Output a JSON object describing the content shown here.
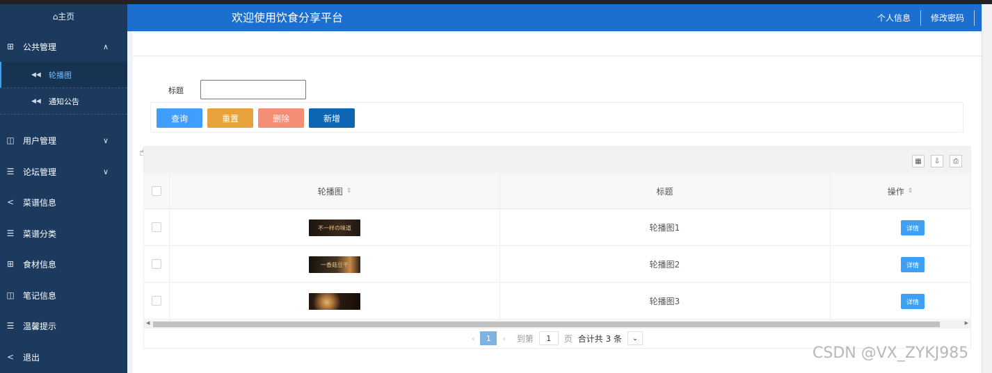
{
  "sidebar": {
    "home": {
      "icon": "home-icon",
      "label": "⌂主页"
    },
    "items": [
      {
        "icon": "grid-icon",
        "label": "公共管理",
        "chevron": "∧"
      },
      {
        "icon": "book-icon",
        "label": "用户管理",
        "chevron": "∨"
      },
      {
        "icon": "list-icon",
        "label": "论坛管理",
        "chevron": "∨"
      },
      {
        "icon": "share-icon",
        "label": "菜谱信息"
      },
      {
        "icon": "list-icon",
        "label": "菜谱分类"
      },
      {
        "icon": "grid-icon",
        "label": "食材信息"
      },
      {
        "icon": "book-icon",
        "label": "笔记信息"
      },
      {
        "icon": "list-icon",
        "label": "温馨提示"
      },
      {
        "icon": "share-icon",
        "label": "退出"
      }
    ],
    "subitems": [
      {
        "icon": "rewind-icon",
        "label": "轮播图",
        "active": true
      },
      {
        "icon": "rewind-icon",
        "label": "通知公告"
      }
    ]
  },
  "header": {
    "title": "欢迎使用饮食分享平台",
    "links": [
      "个人信息",
      "修改密码"
    ],
    "color": "#1c6fcf"
  },
  "search": {
    "label": "标题",
    "value": ""
  },
  "buttons": {
    "query": {
      "label": "查询",
      "color": "#409eff"
    },
    "reset": {
      "label": "重置",
      "color": "#e6a23c"
    },
    "delete": {
      "label": "删除",
      "color": "#f38d73"
    },
    "add": {
      "label": "新增",
      "color": "#0d66b3"
    }
  },
  "table": {
    "columns": [
      "轮播图",
      "标题",
      "操作"
    ],
    "sort_icon": "⇕",
    "rows": [
      {
        "image_text": "不一样の味道",
        "title": "轮播图1",
        "action": "详情"
      },
      {
        "image_text": "一香菇豆干",
        "title": "轮播图2",
        "action": "详情"
      },
      {
        "image_text": "",
        "title": "轮播图3",
        "action": "详情"
      }
    ]
  },
  "pager": {
    "prev": "‹",
    "page": "1",
    "next": "›",
    "goto_label": "到第",
    "goto_value": "1",
    "page_unit": "页",
    "total": "合计共 3 条",
    "select": "⌄"
  },
  "watermark": "CSDN @VX_ZYKJ985"
}
